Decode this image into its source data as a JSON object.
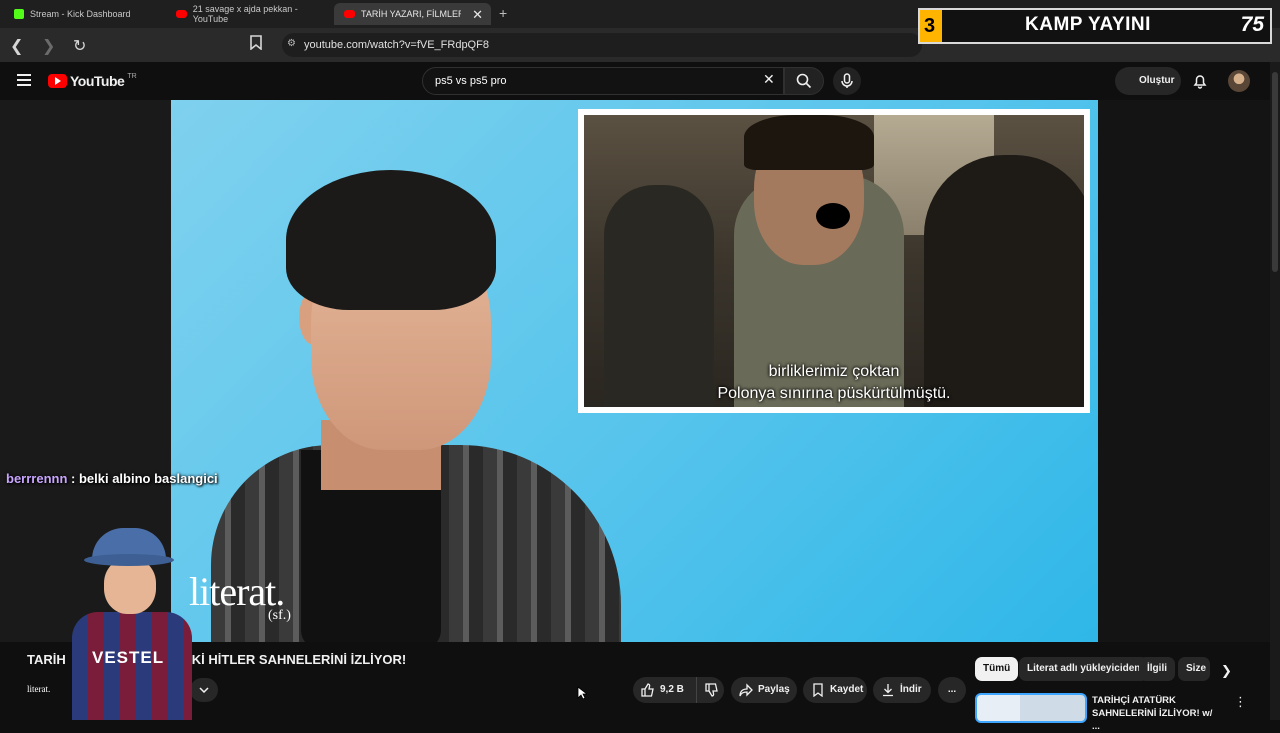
{
  "browser": {
    "tabs": [
      {
        "label": "Stream - Kick Dashboard",
        "favicon": "kick-icon"
      },
      {
        "label": "21 savage x ajda pekkan - YouTube",
        "favicon": "youtube-icon"
      },
      {
        "label": "TARİH YAZARI, FİLMLERDEK",
        "favicon": "youtube-icon"
      }
    ],
    "url": "youtube.com/watch?v=fVE_FRdpQF8"
  },
  "stream_overlay": {
    "number": "3",
    "title": "KAMP YAYINI",
    "count": "75"
  },
  "youtube": {
    "logo_text": "YouTube",
    "region": "TR",
    "search_value": "ps5 vs ps5 pro",
    "create_label": "Oluştur"
  },
  "video": {
    "subtitle_line1": "birliklerimiz çoktan",
    "subtitle_line2": "Polonya sınırına püskürtülmüştü.",
    "watermark": "literat.",
    "watermark_sub": "(sf.)"
  },
  "chat": {
    "user": "berrrennn",
    "message": " : belki albino baslangici"
  },
  "kid_overlay": {
    "shirt_text": "VESTEL"
  },
  "below_video": {
    "title_left": "TARİH",
    "title_right": "Kİ HİTLER SAHNELERİNİ İZLİYOR!",
    "channel_logo": "literat.",
    "like_count": "9,2 B",
    "share_label": "Paylaş",
    "save_label": "Kaydet",
    "download_label": "İndir",
    "more_label": "..."
  },
  "chips": [
    "Tümü",
    "Literat adlı yükleyiciden",
    "İlgili",
    "Size"
  ],
  "recommendation": {
    "title": "TARİHÇİ ATATÜRK SAHNELERİNİ İZLİYOR! w/ ..."
  },
  "colors": {
    "accent": "#ff0000",
    "chat_user": "#c9a5ff",
    "overlay_accent": "#ffb400",
    "video_bg": "#56c4ec"
  }
}
